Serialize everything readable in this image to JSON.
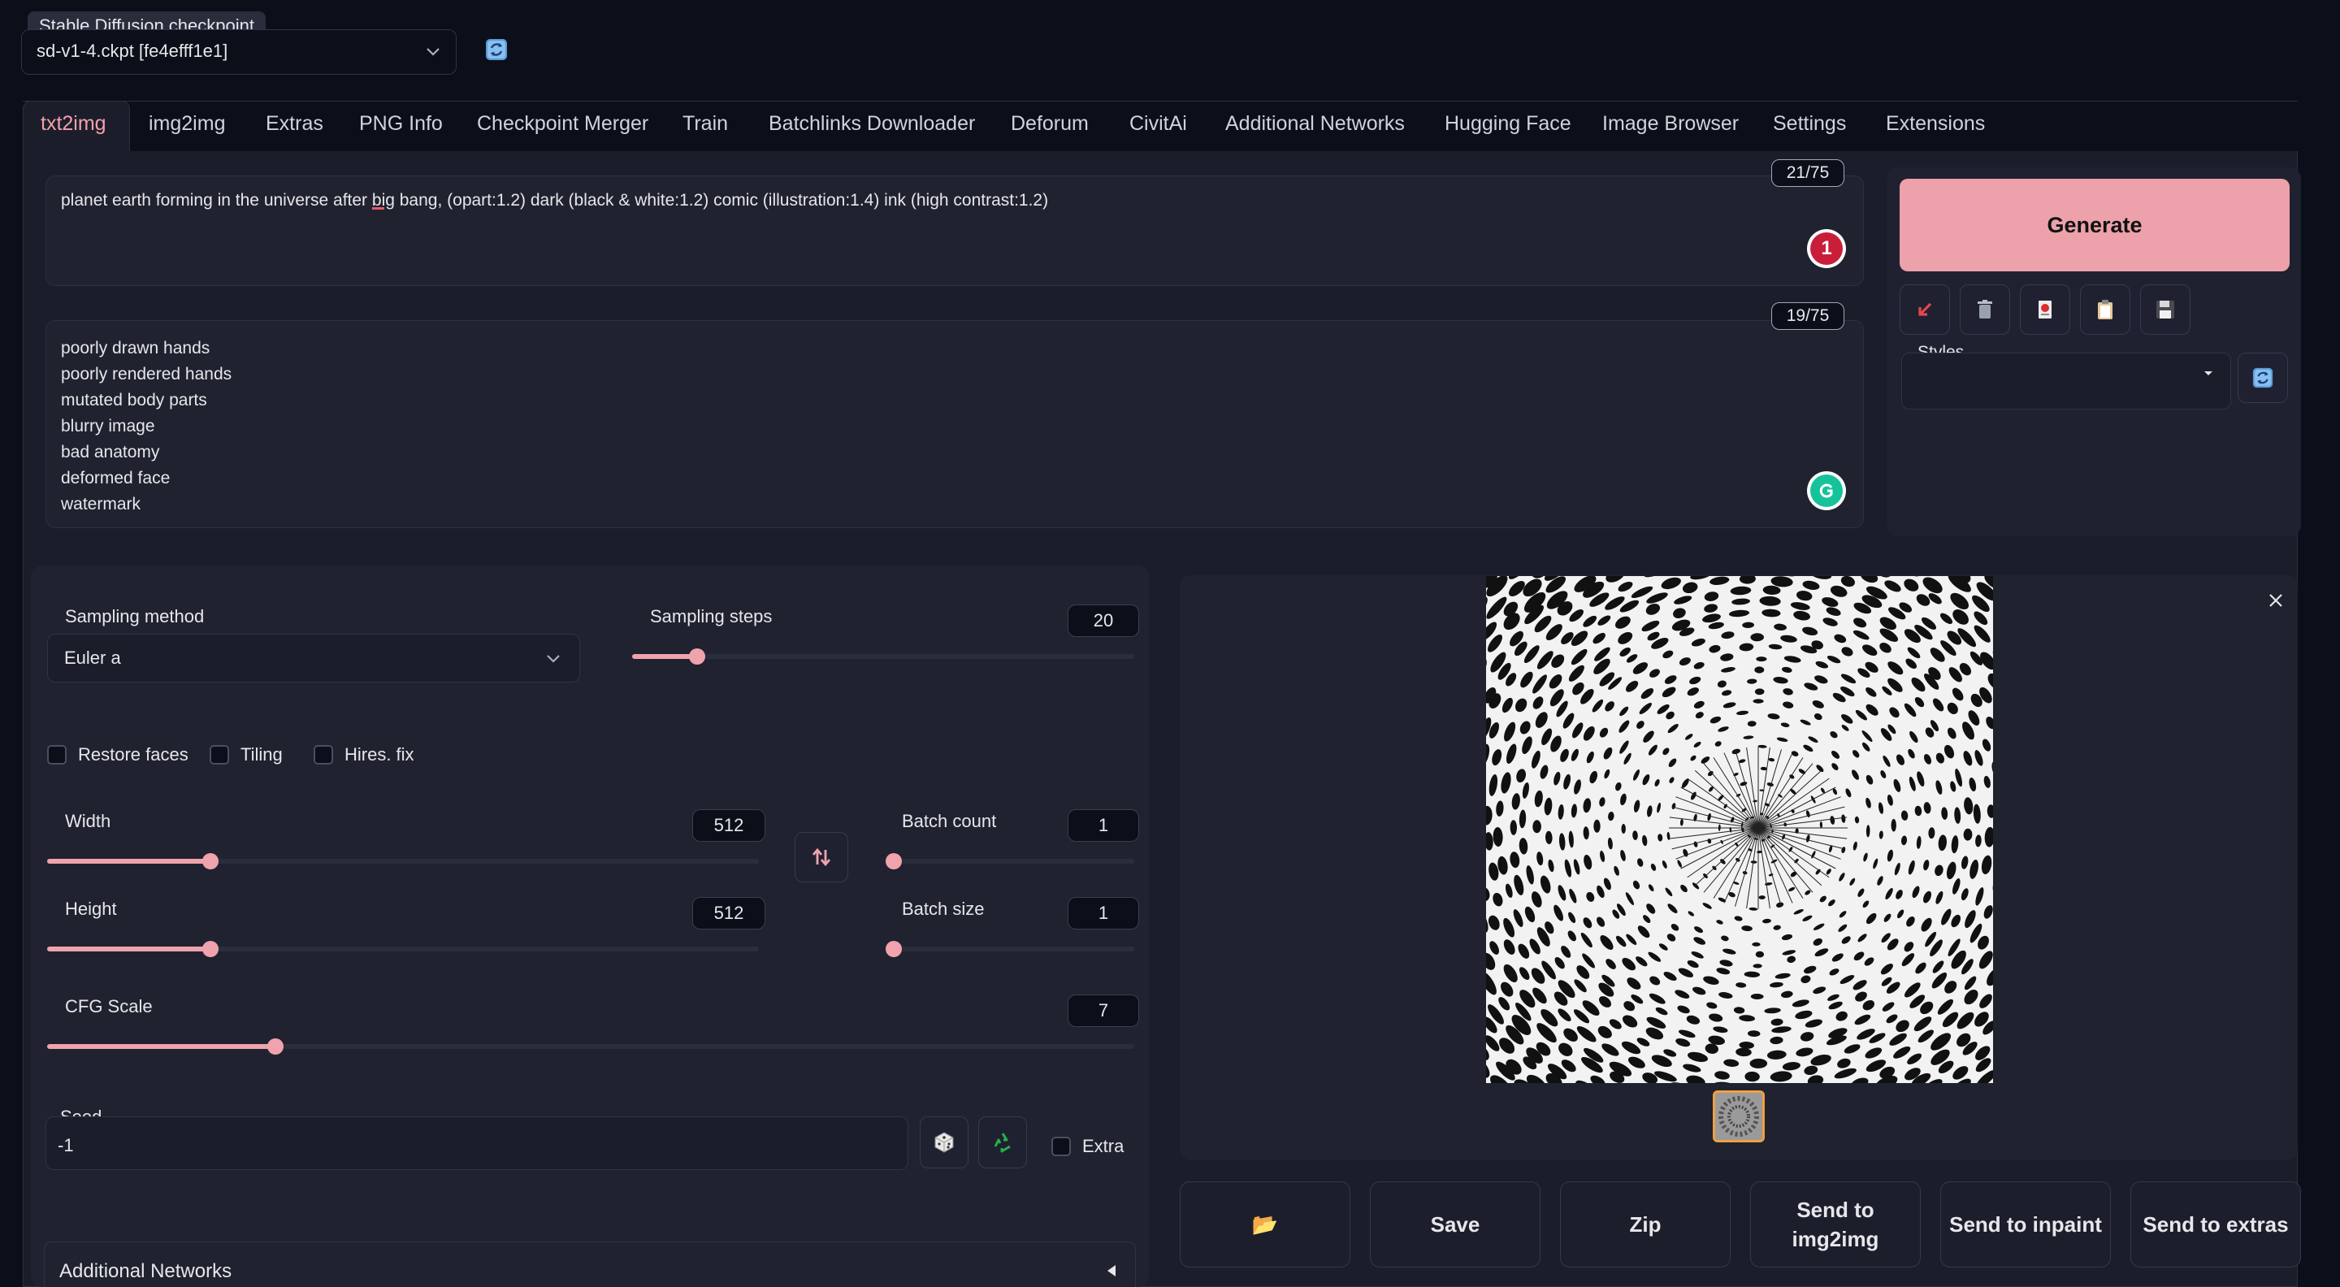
{
  "checkpoint": {
    "label": "Stable Diffusion checkpoint",
    "value": "sd-v1-4.ckpt [fe4efff1e1]"
  },
  "tabs": [
    {
      "label": "txt2img",
      "active": true
    },
    {
      "label": "img2img"
    },
    {
      "label": "Extras"
    },
    {
      "label": "PNG Info"
    },
    {
      "label": "Checkpoint Merger"
    },
    {
      "label": "Train"
    },
    {
      "label": "Batchlinks Downloader"
    },
    {
      "label": "Deforum"
    },
    {
      "label": "CivitAi"
    },
    {
      "label": "Additional Networks"
    },
    {
      "label": "Hugging Face"
    },
    {
      "label": "Image Browser"
    },
    {
      "label": "Settings"
    },
    {
      "label": "Extensions"
    }
  ],
  "prompt": {
    "text_before": "planet earth forming in the universe after ",
    "underlined_word": "big",
    "text_after": " bang, (opart:1.2) dark (black & white:1.2) comic (illustration:1.4) ink (high contrast:1.2)",
    "token_count": "21/75",
    "badge": "1"
  },
  "negative_prompt": {
    "lines": [
      "poorly drawn hands",
      "poorly rendered hands",
      "mutated body parts",
      "blurry image",
      "bad anatomy",
      "deformed face",
      "watermark"
    ],
    "token_count": "19/75"
  },
  "generate": {
    "label": "Generate",
    "color": "#eca1ab"
  },
  "styles": {
    "label": "Styles"
  },
  "settings": {
    "sampling_method_label": "Sampling method",
    "sampling_method_value": "Euler a",
    "sampling_steps_label": "Sampling steps",
    "sampling_steps_value": "20",
    "sampling_steps_fraction": 0.13,
    "restore_faces": "Restore faces",
    "tiling": "Tiling",
    "hires_fix": "Hires. fix",
    "width_label": "Width",
    "width_value": "512",
    "width_fraction": 0.23,
    "height_label": "Height",
    "height_value": "512",
    "height_fraction": 0.23,
    "batch_count_label": "Batch count",
    "batch_count_value": "1",
    "batch_size_label": "Batch size",
    "batch_size_value": "1",
    "cfg_label": "CFG Scale",
    "cfg_value": "7",
    "cfg_fraction": 0.21,
    "seed_label": "Seed",
    "seed_value": "-1",
    "extra_label": "Extra",
    "additional_networks_label": "Additional Networks"
  },
  "output_buttons": {
    "folder": "📂",
    "save": "Save",
    "zip": "Zip",
    "send_img2img": "Send to img2img",
    "send_inpaint": "Send to inpaint",
    "send_extras": "Send to extras"
  },
  "icons": {
    "refresh": "refresh-icon",
    "dice": "dice-icon",
    "recycle": "recycle-icon",
    "swap": "swap-icon",
    "close": "close-icon"
  }
}
